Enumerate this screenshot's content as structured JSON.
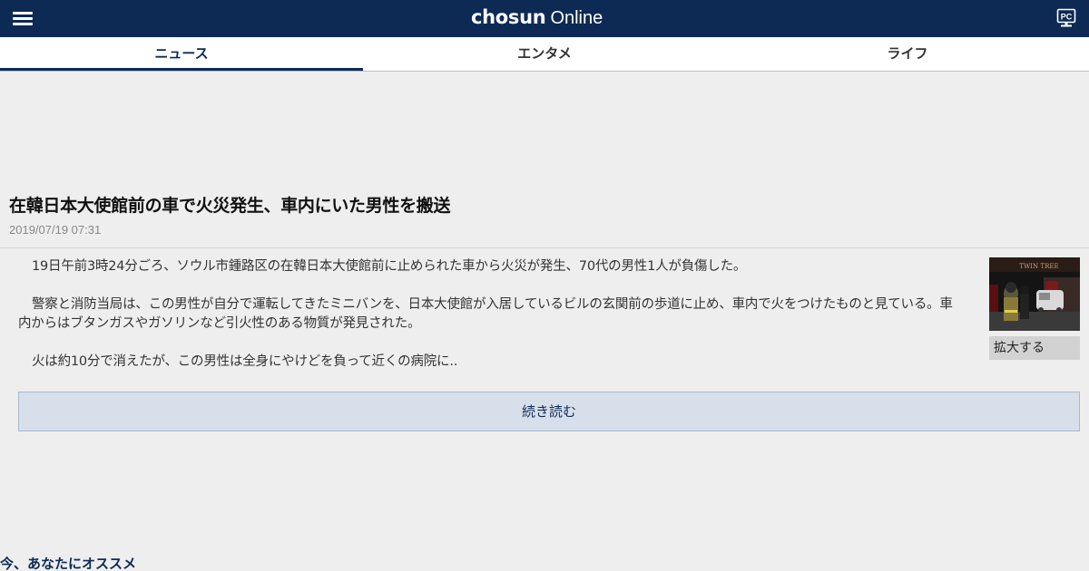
{
  "header": {
    "logo_bold": "chosun",
    "logo_light": "Online",
    "pc_label": "PC"
  },
  "tabs": [
    {
      "label": "ニュース",
      "active": true
    },
    {
      "label": "エンタメ",
      "active": false
    },
    {
      "label": "ライフ",
      "active": false
    }
  ],
  "article": {
    "title": "在韓日本大使館前の車で火災発生、車内にいた男性を搬送",
    "date": "2019/07/19 07:31",
    "paragraphs": [
      "19日午前3時24分ごろ、ソウル市鍾路区の在韓日本大使館前に止められた車から火災が発生、70代の男性1人が負傷した。",
      "警察と消防当局は、この男性が自分で運転してきたミニバンを、日本大使館が入居しているビルの玄関前の歩道に止め、車内で火をつけたものと見ている。車内からはブタンガスやガソリンなど引火性のある物質が発見された。",
      "火は約10分で消えたが、この男性は全身にやけどを負って近くの病院に.."
    ],
    "photo_sign_text": "TWIN TREE",
    "enlarge_label": "拡大する",
    "read_more_label": "続き読む"
  },
  "recommend": {
    "heading": "今、あなたにオススメ"
  },
  "colors": {
    "brand_navy": "#0d2a54",
    "page_bg": "#eeeeee",
    "read_more_bg": "#d7dfeb"
  }
}
